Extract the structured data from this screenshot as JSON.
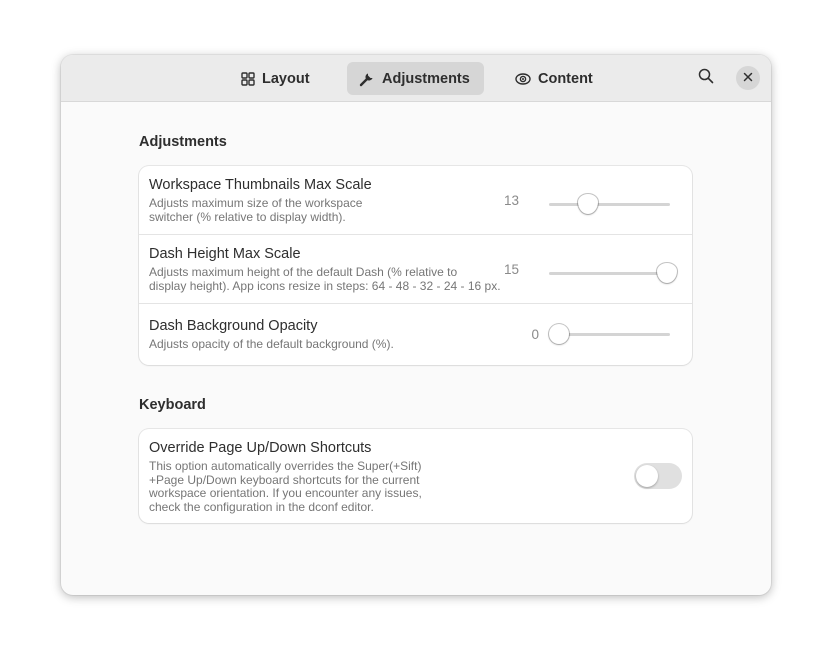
{
  "header": {
    "tabs": [
      {
        "label": "Layout",
        "icon": "grid-icon",
        "active": false
      },
      {
        "label": "Adjustments",
        "icon": "wrench-icon",
        "active": true
      },
      {
        "label": "Content",
        "icon": "eye-icon",
        "active": false
      }
    ],
    "search_icon": "search-icon",
    "close_icon": "close-icon"
  },
  "sections": {
    "adjustments": {
      "title": "Adjustments",
      "rows": [
        {
          "title": "Workspace Thumbnails Max Scale",
          "subtitle_line1": "Adjusts maximum size of the workspace",
          "subtitle_line2": "switcher (% relative to display width).",
          "value": "13",
          "fraction": 0.32
        },
        {
          "title": "Dash Height Max Scale",
          "subtitle_line1": "Adjusts maximum height of the default Dash (% relative to",
          "subtitle_line2": "display height). App icons resize in steps: 64 - 48 - 32 - 24 - 16 px.",
          "value": "15",
          "fraction": 1.0
        },
        {
          "title": "Dash Background Opacity",
          "subtitle_line1": "Adjusts opacity of the default background (%).",
          "value": "0",
          "fraction": 0.0
        }
      ]
    },
    "keyboard": {
      "title": "Keyboard",
      "rows": [
        {
          "title": "Override Page Up/Down Shortcuts",
          "subtitle_lines": [
            "This option automatically overrides the Super(+Sift)",
            "+Page Up/Down keyboard shortcuts for the current",
            "workspace orientation. If you encounter any issues,",
            "check the configuration in the dconf editor."
          ],
          "toggle_on": false
        }
      ]
    }
  },
  "colors": {
    "window_bg": "#fafafa",
    "headerbar_bg": "#ebebeb",
    "active_tab_bg": "#d6d6d6",
    "card_bg": "#ffffff",
    "slider_track": "#d4d4d4",
    "switch_off": "#e0e0e0"
  }
}
